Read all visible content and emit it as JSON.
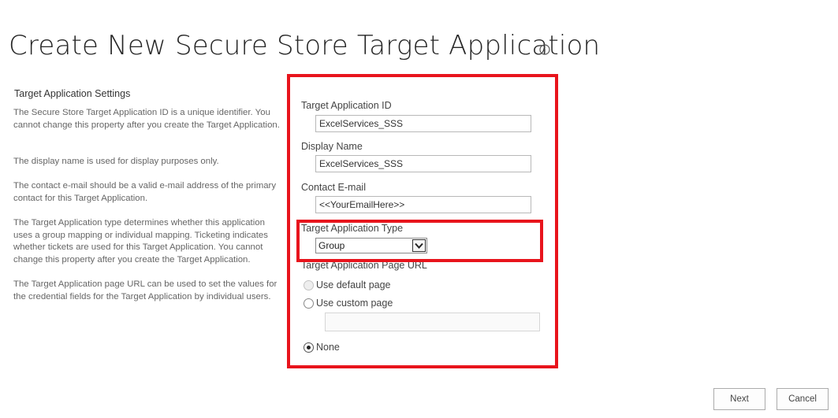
{
  "page": {
    "title": "Create New Secure Store Target Application",
    "info_icon": "info-icon"
  },
  "settings": {
    "heading": "Target Application Settings",
    "descriptions": [
      "The Secure Store Target Application ID is a unique identifier. You cannot change this property after you create the Target Application.",
      "The display name is used for display purposes only.",
      "The contact e-mail should be a valid e-mail address of the primary contact for this Target Application.",
      "The Target Application type determines whether this application uses a group mapping or individual mapping. Ticketing indicates whether tickets are used for this Target Application. You cannot change this property after you create the Target Application.",
      "The Target Application page URL can be used to set the values for the credential fields for the Target Application by individual users."
    ]
  },
  "form": {
    "app_id": {
      "label": "Target Application ID",
      "value": "ExcelServices_SSS"
    },
    "display_name": {
      "label": "Display Name",
      "value": "ExcelServices_SSS"
    },
    "contact_email": {
      "label": "Contact E-mail",
      "value": "<<YourEmailHere>>"
    },
    "app_type": {
      "label": "Target Application Type",
      "selected": "Group"
    },
    "page_url": {
      "label": "Target Application Page URL",
      "options": [
        {
          "label": "Use default page",
          "checked": false,
          "disabled": true
        },
        {
          "label": "Use custom page",
          "checked": false,
          "disabled": false
        },
        {
          "label": "None",
          "checked": true,
          "disabled": false
        }
      ],
      "custom_url_value": ""
    }
  },
  "buttons": {
    "next": "Next",
    "cancel": "Cancel"
  },
  "colors": {
    "highlight": "#e8141c",
    "title": "#262626",
    "description": "#666666"
  }
}
